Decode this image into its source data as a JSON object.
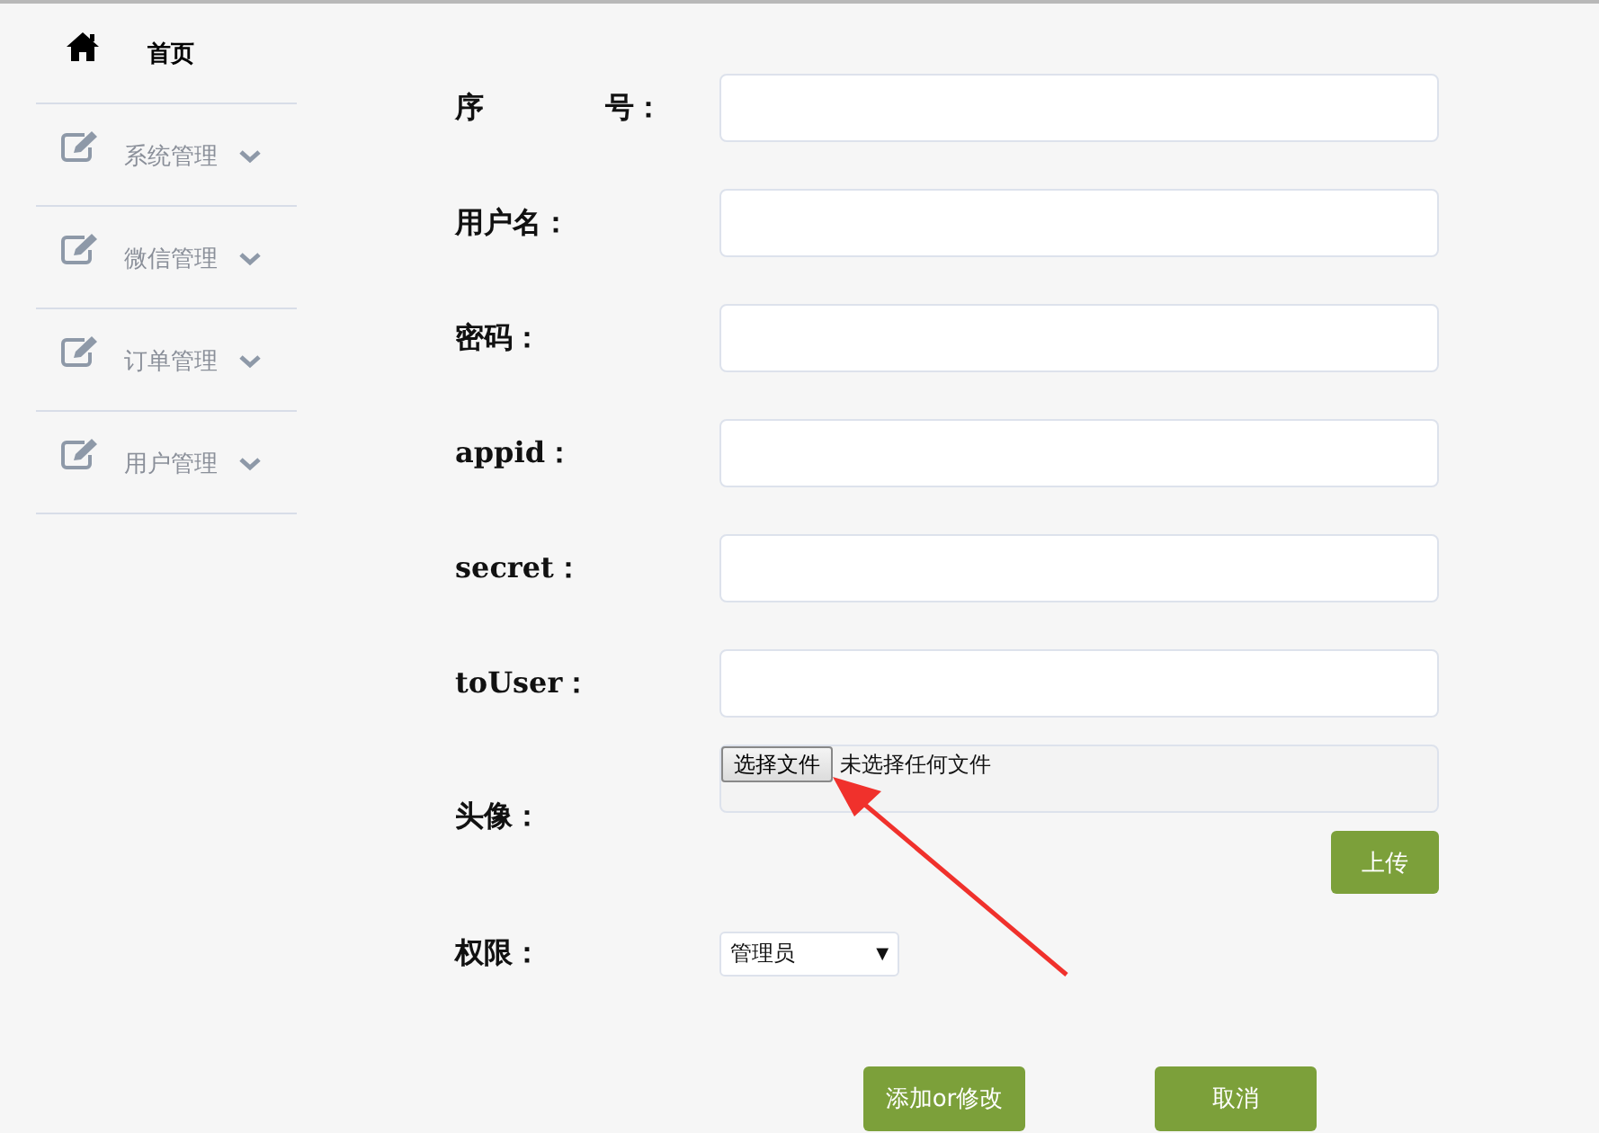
{
  "sidebar": {
    "home": {
      "label": "首页"
    },
    "items": [
      {
        "label": "系统管理",
        "expanded": false
      },
      {
        "label": "微信管理",
        "expanded": false
      },
      {
        "label": "订单管理",
        "expanded": false
      },
      {
        "label": "用户管理",
        "expanded": false
      }
    ]
  },
  "form": {
    "fields": [
      {
        "label": "序 号："
      },
      {
        "label": "用户名："
      },
      {
        "label": "密码："
      },
      {
        "label": "appid："
      },
      {
        "label": "secret："
      },
      {
        "label": "toUser："
      }
    ],
    "avatar": {
      "label": "头像：",
      "file_button": "选择文件",
      "file_status": "未选择任何文件",
      "upload": "上传"
    },
    "permission": {
      "label": "权限：",
      "value": "管理员",
      "caret": "▼"
    },
    "buttons": [
      "添加or修改",
      "取消"
    ]
  }
}
